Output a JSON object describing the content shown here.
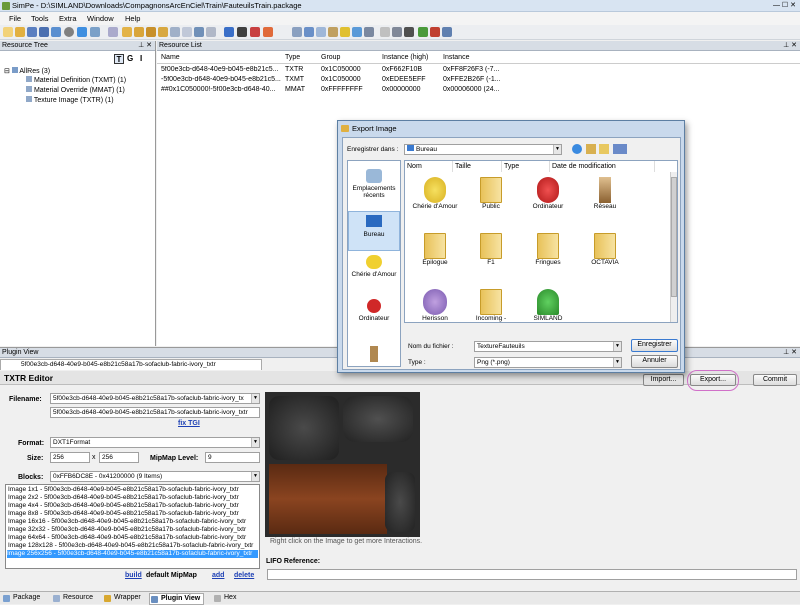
{
  "window": {
    "title": "SimPe - D:\\SIMLAND\\Downloads\\CompagnonsArcEnCiel\\Train\\FauteuilsTrain.package"
  },
  "menu": [
    "File",
    "Tools",
    "Extra",
    "Window",
    "Help"
  ],
  "resource_tree": {
    "header": "Resource Tree",
    "buttons": [
      "T",
      "G",
      "I"
    ],
    "root": "AllRes (3)",
    "items": [
      "Material Definition (TXMT) (1)",
      "Material Override (MMAT) (1)",
      "Texture Image (TXTR) (1)"
    ]
  },
  "resource_list": {
    "header": "Resource List",
    "columns": [
      "Name",
      "Type",
      "Group",
      "Instance (high)",
      "Instance"
    ],
    "rows": [
      [
        "5f00e3cb-d648-40e9-b045-e8b21c5...",
        "TXTR",
        "0x1C050000",
        "0xF662F10B",
        "0xFF8F26F3 (-7..."
      ],
      [
        "-5f00e3cb-d648-40e9-b045-e8b21c5...",
        "TXMT",
        "0x1C050000",
        "0xEDEE5EFF",
        "0xFFE2B26F (-1..."
      ],
      [
        "##0x1C050000!-5f00e3cb-d648-40...",
        "MMAT",
        "0xFFFFFFFF",
        "0x00000000",
        "0x00006000 (24..."
      ]
    ]
  },
  "plugin_view": {
    "header": "Plugin View",
    "tab": "5f00e3cb-d648-40e9-b045-e8b21c58a17b-sofaclub-fabric-ivory_txtr",
    "editor_title": "TXTR Editor",
    "import_label": "Import...",
    "export_label": "Export...",
    "commit_label": "Commit",
    "filename_label": "Filename:",
    "filename_combo": "5f00e3cb-d648-40e9-b045-e8b21c58a17b-sofaclub-fabric-ivory_tx",
    "filename_value": "5f00e3cb-d648-40e9-b045-e8b21c58a17b-sofaclub-fabric-ivory_txtr",
    "fix_tgi": "fix TGI",
    "format_label": "Format:",
    "format_value": "DXT1Format",
    "size_label": "Size:",
    "size_w": "256",
    "size_x": "x",
    "size_h": "256",
    "mipmap_label": "MipMap Level:",
    "mipmap_value": "9",
    "blocks_label": "Blocks:",
    "blocks_value": "0xFFB6DC8E - 0x41200000 (9 Items)",
    "blocks": [
      "Image 1x1 - 5f00e3cb-d648-40e9-b045-e8b21c58a17b-sofaclub-fabric-ivory_txtr",
      "Image 2x2 - 5f00e3cb-d648-40e9-b045-e8b21c58a17b-sofaclub-fabric-ivory_txtr",
      "Image 4x4 - 5f00e3cb-d648-40e9-b045-e8b21c58a17b-sofaclub-fabric-ivory_txtr",
      "Image 8x8 - 5f00e3cb-d648-40e9-b045-e8b21c58a17b-sofaclub-fabric-ivory_txtr",
      "Image 16x16 - 5f00e3cb-d648-40e9-b045-e8b21c58a17b-sofaclub-fabric-ivory_txtr",
      "Image 32x32 - 5f00e3cb-d648-40e9-b045-e8b21c58a17b-sofaclub-fabric-ivory_txtr",
      "Image 64x64 - 5f00e3cb-d648-40e9-b045-e8b21c58a17b-sofaclub-fabric-ivory_txtr",
      "Image 128x128 - 5f00e3cb-d648-40e9-b045-e8b21c58a17b-sofaclub-fabric-ivory_txtr",
      "Image 256x256 - 5f00e3cb-d648-40e9-b045-e8b21c58a17b-sofaclub-fabric-ivory_txtr"
    ],
    "selected_block": 8,
    "build": "build",
    "default_mipmap": "default MipMap",
    "add": "add",
    "delete": "delete",
    "image_hint": "Right click on the Image to get more Interactions.",
    "lifo_label": "LIFO Reference:"
  },
  "status_tabs": [
    "Package",
    "Resource",
    "Wrapper",
    "Plugin View",
    "Hex"
  ],
  "export_dialog": {
    "title": "Export Image",
    "save_in_label": "Enregistrer dans :",
    "save_in_value": "Bureau",
    "places": [
      "Emplacements récents",
      "Bureau",
      "Chérie d'Amour",
      "Ordinateur"
    ],
    "columns": [
      "Nom",
      "Taille",
      "Type",
      "Date de modification"
    ],
    "files": [
      "Chérie d'Amour",
      "Public",
      "Ordinateur",
      "Réseau",
      "Epilogue",
      "F1",
      "Fringues",
      "OCTAVIA",
      "Herisson",
      "Incoming -",
      "SIMLAND"
    ],
    "filename_label": "Nom du fichier :",
    "filename_value": "TextureFauteuils",
    "type_label": "Type :",
    "type_value": "Png (*.png)",
    "save_button": "Enregistrer",
    "cancel_button": "Annuler"
  },
  "colors": {
    "selection": "#3399ff",
    "highlight_circle": "#d070c8",
    "link": "#1c3fb4"
  }
}
